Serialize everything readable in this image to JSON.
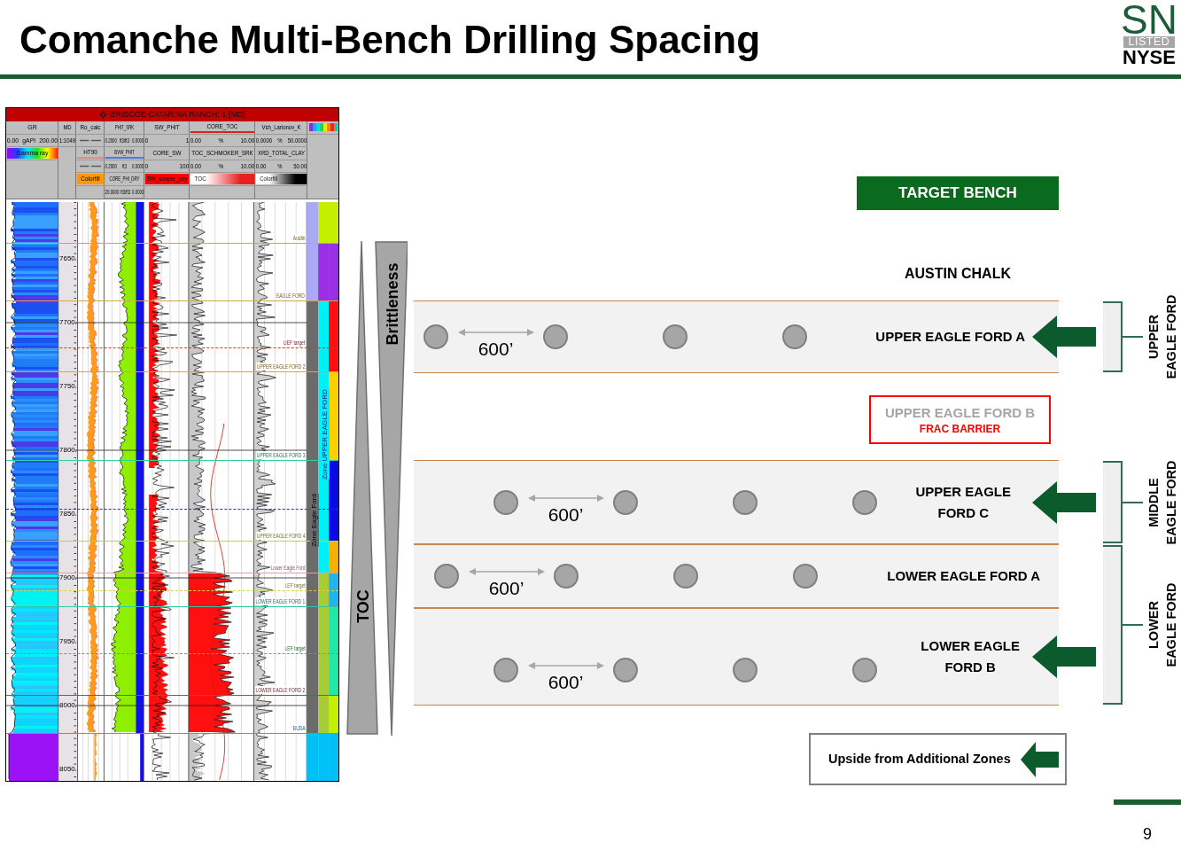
{
  "title": "Comanche Multi-Bench Drilling Spacing",
  "logo": {
    "mark": "SN",
    "listed": "LISTED",
    "exchange": "NYSE"
  },
  "well_log": {
    "title": "BRISCOE CATARINA RANCH: 1 [MD]",
    "tracks": [
      {
        "entries": [
          {
            "kind": "title",
            "text": "GR"
          },
          {
            "kind": "scale",
            "values": [
              "0.00",
              "gAPI",
              "200.00"
            ]
          },
          {
            "kind": "rainbow",
            "text": "Gamma ray"
          }
        ]
      },
      {
        "entries": [
          {
            "kind": "title",
            "text": "MD"
          },
          {
            "kind": "scale",
            "values": [
              "1:1049"
            ]
          }
        ]
      },
      {
        "entries": [
          {
            "kind": "title",
            "text": "Ro_calc"
          },
          {
            "kind": "illegible"
          },
          {
            "kind": "title",
            "text": "HT90",
            "color": "#e08a8a"
          },
          {
            "kind": "illegible"
          },
          {
            "kind": "fill",
            "text": "Colorfill",
            "color": "#ff9900"
          }
        ]
      },
      {
        "entries": [
          {
            "kind": "title",
            "text": "PHIT_SRK"
          },
          {
            "kind": "scale",
            "values": [
              "0.2000",
              "ft3/ft3",
              "0.0000"
            ]
          },
          {
            "kind": "title",
            "text": "BVW_PHIT",
            "color": "#4a7ae0"
          },
          {
            "kind": "scale",
            "values": [
              "0.2000",
              "ft3",
              "0.0000"
            ]
          },
          {
            "kind": "title",
            "text": "CORE_PHI_DRY"
          },
          {
            "kind": "scale",
            "values": [
              "20.0000",
              "ft3/ft3",
              "0.0000"
            ]
          }
        ]
      },
      {
        "entries": [
          {
            "kind": "title",
            "text": "SW_PHIT"
          },
          {
            "kind": "scale",
            "values": [
              "0",
              "1"
            ]
          },
          {
            "kind": "title",
            "text": "CORE_SW"
          },
          {
            "kind": "scale",
            "values": [
              "0",
              "100"
            ]
          },
          {
            "kind": "fill",
            "text": "SW_simple_pay",
            "color": "#ff0000"
          }
        ]
      },
      {
        "entries": [
          {
            "kind": "title",
            "text": "CORE_TOC",
            "color": "#e02020"
          },
          {
            "kind": "scale",
            "values": [
              "0.00",
              "%",
              "10.00"
            ]
          },
          {
            "kind": "title",
            "text": "TOC_SCHMOKER_SRK"
          },
          {
            "kind": "scale",
            "values": [
              "0.00",
              "%",
              "10.00"
            ]
          },
          {
            "kind": "gradient",
            "text": "TOC",
            "color": "#e82020"
          }
        ]
      },
      {
        "entries": [
          {
            "kind": "title",
            "text": "Vsh_Larionov_K"
          },
          {
            "kind": "scale",
            "values": [
              "0.0000",
              "%",
              "50.0000"
            ]
          },
          {
            "kind": "title",
            "text": "XRD_TOTAL_CLAY"
          },
          {
            "kind": "scale",
            "values": [
              "0.00",
              "%",
              "50.00"
            ]
          },
          {
            "kind": "gradient",
            "text": "Colorfill",
            "color": "#000000"
          }
        ]
      },
      {
        "entries": [
          {
            "kind": "legend"
          }
        ]
      }
    ],
    "depths": [
      "7650",
      "7700",
      "7750",
      "7800",
      "7850",
      "7900",
      "7950",
      "8000",
      "8050"
    ],
    "markers": [
      {
        "label": "Austin",
        "color": "#d9a441",
        "dashed": false
      },
      {
        "label": "EAGLE FORD",
        "color": "#d9a441",
        "dashed": false
      },
      {
        "label": "UEF target",
        "color": "#e03030",
        "dashed": true
      },
      {
        "label": "UPPER EAGLE FORD 2",
        "color": "#d9a441",
        "dashed": false
      },
      {
        "label": "UPPER EAGLE FORD 3",
        "color": "#30d0a0",
        "dashed": false
      },
      {
        "color": "#2030e0",
        "dashed": true
      },
      {
        "label": "UPPER EAGLE FORD 4",
        "color": "#b4d84a",
        "dashed": false
      },
      {
        "label": "Lower Eagle Ford",
        "color": "#e8a0a8",
        "dashed": false
      },
      {
        "label": "LEF target",
        "color": "#e0d040",
        "dashed": true
      },
      {
        "label": "LOWER EAGLE FORD 1",
        "color": "#30c8a8",
        "dashed": false
      },
      {
        "label": "LEF target",
        "color": "#40c040",
        "dashed": true
      },
      {
        "label": "LOWER EAGLE FORD 2",
        "color": "#c83848",
        "dashed": false
      },
      {
        "label": "BUDA",
        "color": "#30a8e8",
        "dashed": false
      }
    ],
    "zone_labels": [
      "Zone Eagle Ford",
      "Zone UPPER EAGLE FORD"
    ]
  },
  "trends": [
    {
      "kind": "widening_down",
      "label": "TOC"
    },
    {
      "kind": "widening_up",
      "label": "Brittleness"
    }
  ],
  "target_bench": "TARGET BENCH",
  "top_formation": "AUSTIN CHALK",
  "zones": [
    {
      "kind": "group",
      "bracket": [
        "UPPER",
        "EAGLE FORD"
      ],
      "benches": [
        {
          "label": [
            "UPPER EAGLE FORD A"
          ],
          "spacing": "600’",
          "targeted": true
        }
      ]
    },
    {
      "kind": "barrier",
      "label": "UPPER EAGLE FORD B",
      "note": "FRAC BARRIER"
    },
    {
      "kind": "group",
      "bracket": [
        "MIDDLE",
        "EAGLE FORD"
      ],
      "benches": [
        {
          "label": [
            "UPPER EAGLE",
            "FORD C"
          ],
          "spacing": "600’",
          "targeted": true
        }
      ]
    },
    {
      "kind": "group",
      "bracket": [
        "LOWER",
        "EAGLE FORD"
      ],
      "benches": [
        {
          "label": [
            "LOWER EAGLE FORD A"
          ],
          "spacing": "600’",
          "targeted": false
        },
        {
          "label": [
            "LOWER EAGLE",
            "FORD B"
          ],
          "spacing": "600’",
          "targeted": true
        }
      ]
    }
  ],
  "upside": "Upside from Additional Zones",
  "page_number": "9"
}
